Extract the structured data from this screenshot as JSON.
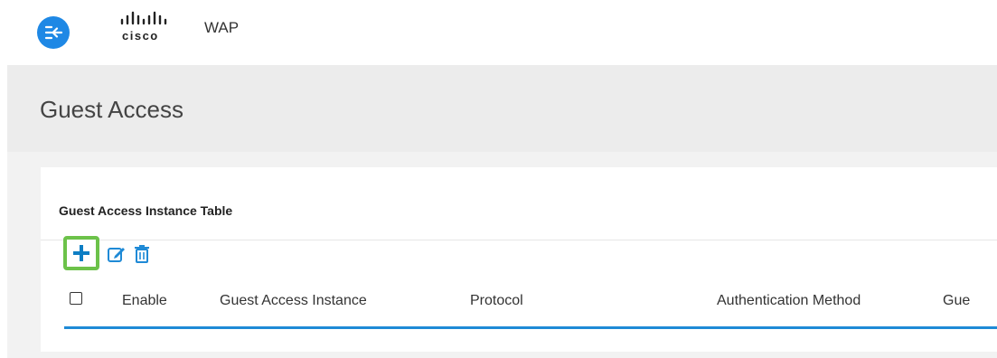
{
  "header": {
    "app_name": "WAP",
    "logo_text": "cisco",
    "menu_icon": "menu-collapse-icon",
    "accent": "#1e88e5"
  },
  "page": {
    "title": "Guest Access"
  },
  "panel": {
    "title": "Guest Access Instance Table",
    "toolbar": {
      "add_icon": "plus-icon",
      "edit_icon": "edit-icon",
      "delete_icon": "trash-icon",
      "highlight_color": "#6cc24a"
    },
    "table": {
      "columns": [
        "Enable",
        "Guest Access Instance",
        "Protocol",
        "Authentication Method",
        "Gue"
      ],
      "rows": []
    }
  }
}
